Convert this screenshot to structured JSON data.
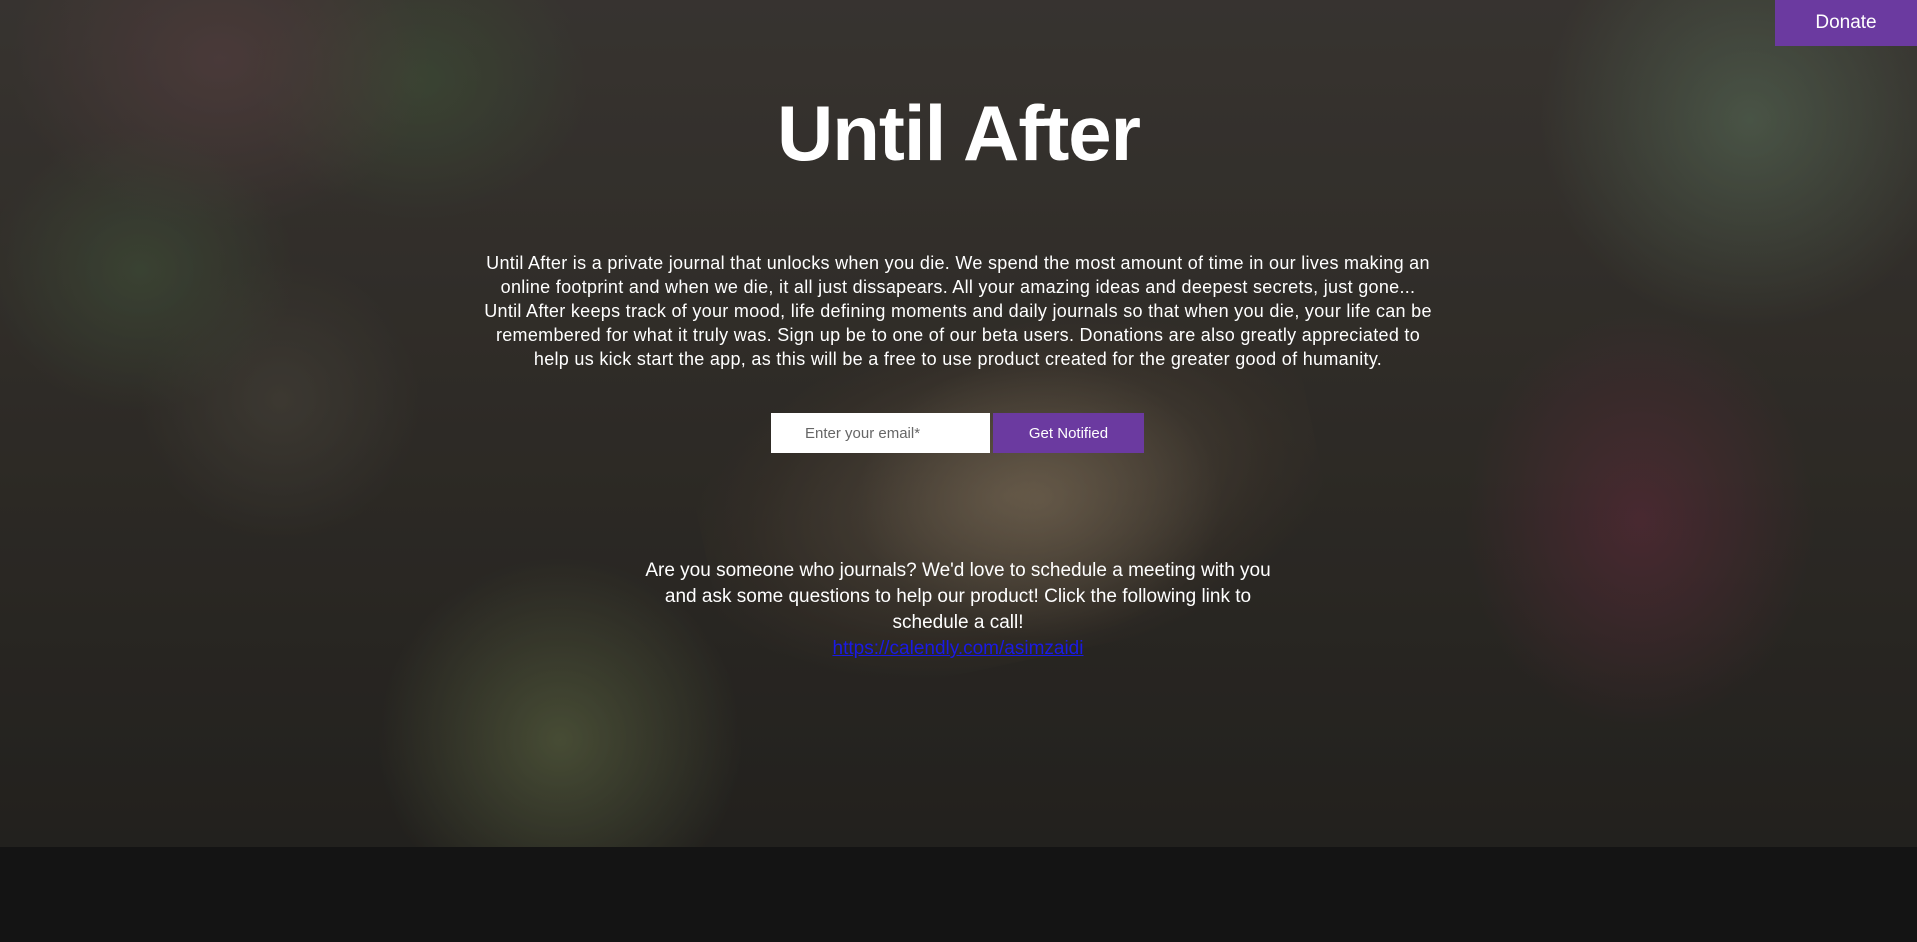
{
  "header": {
    "donate_label": "Donate"
  },
  "hero": {
    "title": "Until After",
    "description": "Until After is a private journal that unlocks when you die. We spend the most amount of time in our lives making an online footprint and when we die, it all just dissapears. All your amazing ideas and deepest secrets, just gone... Until After keeps track of your mood, life defining moments and daily journals so that when you die, your life can be remembered for what it truly was. Sign up be to one of our beta users. Donations are also greatly appreciated to help us kick start the app, as this will be a free to use product created for the greater good of humanity."
  },
  "signup": {
    "email_placeholder": "Enter your email*",
    "email_value": "",
    "submit_label": "Get Notified"
  },
  "journal_cta": {
    "text": "Are you someone who journals? We'd love to schedule a meeting with you and ask some questions to help our product! Click the following link to schedule a call!",
    "link_text": "https://calendly.com/asimzaidi",
    "link_href": "https://calendly.com/asimzaidi"
  },
  "colors": {
    "accent": "#6b3aa0",
    "link": "#1a1ae6",
    "footer_bg": "#141414"
  }
}
